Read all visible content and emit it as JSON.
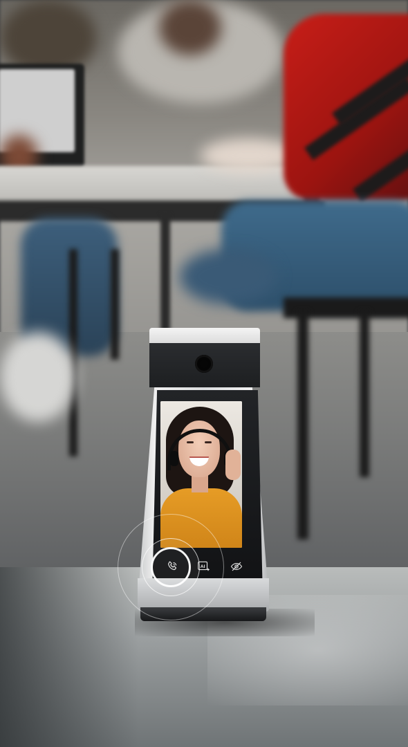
{
  "scene": {
    "description_colors": {
      "sweater": "#c81e18",
      "shirt_on_screen": "#e69c26",
      "device_dark": "#1d1f21",
      "device_silver": "#dcdedf"
    }
  },
  "device": {
    "controls": [
      {
        "icon": "phone-call-icon"
      },
      {
        "icon": "ai-sparkle-icon",
        "label": "AI"
      },
      {
        "icon": "eye-off-icon"
      }
    ]
  }
}
